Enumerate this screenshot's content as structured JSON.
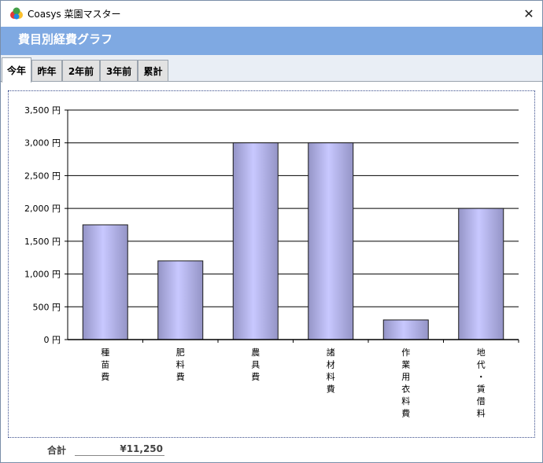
{
  "window": {
    "title": "Coasys 菜園マスター"
  },
  "header": {
    "title": "費目別経費グラフ"
  },
  "tabs": [
    {
      "label": "今年",
      "active": true
    },
    {
      "label": "昨年",
      "active": false
    },
    {
      "label": "2年前",
      "active": false
    },
    {
      "label": "3年前",
      "active": false
    },
    {
      "label": "累計",
      "active": false
    }
  ],
  "summary": {
    "total_label": "合計",
    "total_value": "¥11,250"
  },
  "chart_data": {
    "type": "bar",
    "categories": [
      "種苗費",
      "肥料費",
      "農具費",
      "諸材料費",
      "作業用衣料費",
      "地代・賃借料"
    ],
    "values": [
      1750,
      1200,
      3000,
      3000,
      300,
      2000
    ],
    "ylim": [
      0,
      3500
    ],
    "yticks": [
      0,
      500,
      1000,
      1500,
      2000,
      2500,
      3000,
      3500
    ],
    "ytick_labels": [
      "0 円",
      "500 円",
      "1,000 円",
      "1,500 円",
      "2,000 円",
      "2,500 円",
      "3,000 円",
      "3,500 円"
    ],
    "grid": true,
    "colors": {
      "bar_light": "#c8c8ff",
      "bar_dark": "#9494c6",
      "bar_edge": "#1a1a1a",
      "grid": "#000000"
    }
  }
}
